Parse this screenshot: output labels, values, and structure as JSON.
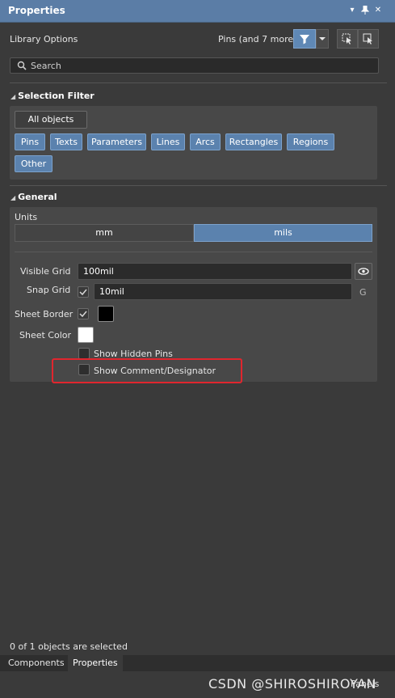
{
  "window": {
    "title": "Properties"
  },
  "titlebar_icons": [
    "chevron-down-icon",
    "pin-icon",
    "close-icon"
  ],
  "header": {
    "library_options": "Library Options",
    "filter_summary": "Pins (and 7 more)"
  },
  "search": {
    "placeholder": "Search"
  },
  "selection_filter": {
    "title": "Selection Filter",
    "all_objects": "All objects",
    "chips": [
      "Pins",
      "Texts",
      "Parameters",
      "Lines",
      "Arcs",
      "Rectangles",
      "Regions",
      "Other"
    ]
  },
  "general": {
    "title": "General",
    "units_label": "Units",
    "units_options": [
      "mm",
      "mils"
    ],
    "units_selected": "mils",
    "visible_grid_label": "Visible Grid",
    "visible_grid_value": "100mil",
    "snap_grid_label": "Snap Grid",
    "snap_grid_value": "10mil",
    "snap_grid_key": "G",
    "sheet_border_label": "Sheet Border",
    "sheet_border_color": "#000000",
    "sheet_color_label": "Sheet Color",
    "sheet_color": "#ffffff",
    "show_hidden_pins": "Show Hidden Pins",
    "show_comment_designator": "Show Comment/Designator"
  },
  "status": {
    "selection": "0 of 1 objects are selected"
  },
  "tabs": [
    "Components",
    "Properties"
  ],
  "active_tab": "Properties",
  "bottom": {
    "panels_button": "Panels"
  },
  "watermark": "CSDN @SHIROSHIROYAN",
  "colors": {
    "accent": "#5b82ae",
    "title_bar": "#5b7da6",
    "highlight": "#e0262e"
  }
}
